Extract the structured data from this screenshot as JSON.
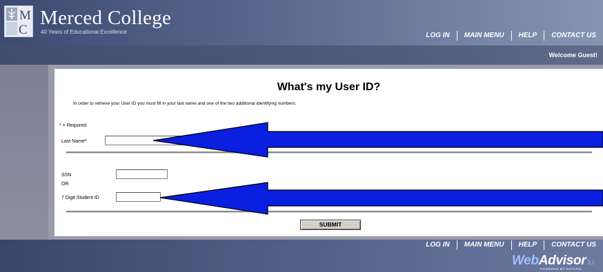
{
  "header": {
    "college_name": "Merced College",
    "tagline": "40 Years of Educational Excellence",
    "logo_letters": "MC"
  },
  "nav": [
    {
      "label": "Log In"
    },
    {
      "label": "Main Menu"
    },
    {
      "label": "Help"
    },
    {
      "label": "Contact Us"
    }
  ],
  "welcome": "Welcome Guest!",
  "form": {
    "title": "What's my User ID?",
    "instructions": "In order to retrieve your User ID you must fill in your last name and one of the two additional identifying numbers.",
    "required_note": "* = Required",
    "last_name_label": "Last Name",
    "required_mark": "*",
    "last_name_value": "",
    "ssn_label": "SSN",
    "ssn_value": "",
    "or_label": "OR",
    "student_id_label": "7 Digit Student ID",
    "student_id_value": "",
    "submit_label": "SUBMIT"
  },
  "annotations": {
    "arrow_color": "#0a1fe0"
  },
  "footer": {
    "brand_web": "Web",
    "brand_advisor": "Advisor",
    "version": "3.1",
    "powered_by": "POWERED BY DATATEL"
  }
}
